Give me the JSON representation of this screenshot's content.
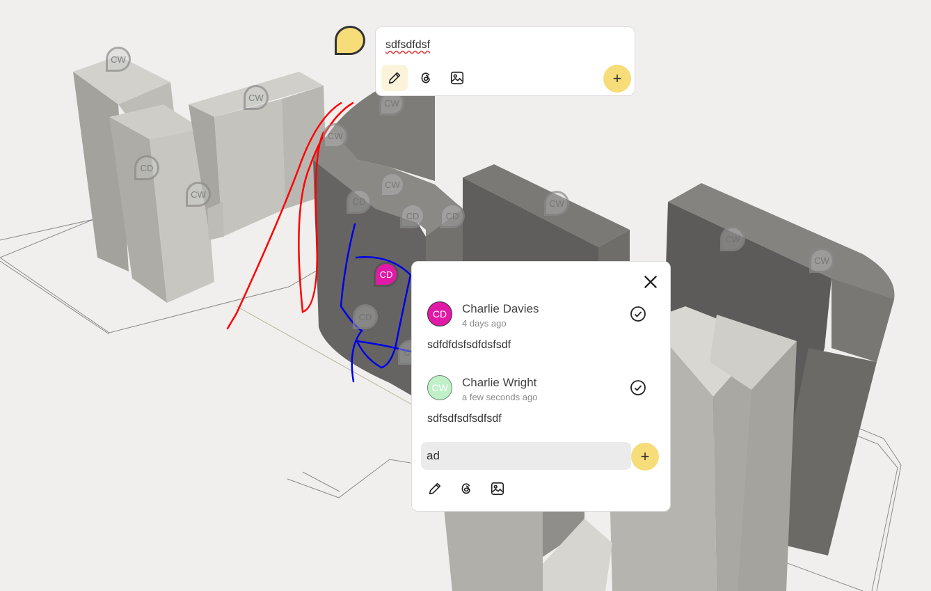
{
  "colors": {
    "accent": "#f7dc7a",
    "annotation_red": "#ff0000",
    "annotation_blue": "#0000e6",
    "avatar_cd": "#e01aa6",
    "avatar_cw": "#bff0c8"
  },
  "markers": [
    {
      "label": "CW"
    },
    {
      "label": "CW"
    },
    {
      "label": "CW"
    },
    {
      "label": "CW"
    },
    {
      "label": "CW"
    },
    {
      "label": "CW"
    },
    {
      "label": "CW"
    },
    {
      "label": "CW"
    },
    {
      "label": "CW"
    },
    {
      "label": "CD"
    },
    {
      "label": "CD"
    },
    {
      "label": "CD"
    },
    {
      "label": "CD"
    },
    {
      "label": "CD"
    },
    {
      "label": "CD"
    },
    {
      "label": "CD"
    }
  ],
  "composer": {
    "text": "sdfsdfdsf",
    "tools": [
      "pencil-icon",
      "threads-icon",
      "image-icon"
    ],
    "add_label": "+"
  },
  "thread": {
    "close_icon": "close-icon",
    "comments": [
      {
        "initials": "CD",
        "author": "Charlie Davies",
        "time": "4 days ago",
        "text": "sdfdfdsfsdfdsfsdf",
        "resolve_icon": "check-circle-icon"
      },
      {
        "initials": "CW",
        "author": "Charlie Wright",
        "time": "a few seconds ago",
        "text": "sdfsdfsdfsdfsdf",
        "resolve_icon": "check-circle-icon"
      }
    ],
    "reply_value": "ad",
    "add_label": "+",
    "tools": [
      "pencil-icon",
      "threads-icon",
      "image-icon"
    ]
  }
}
